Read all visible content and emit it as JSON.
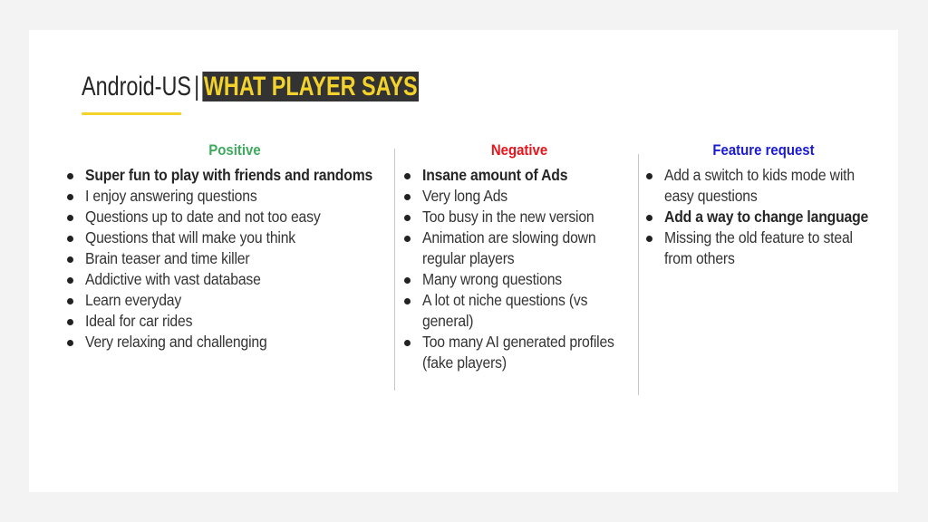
{
  "title": {
    "prefix": "Android-US",
    "separator": "|",
    "highlight": "WHAT PLAYER SAYS"
  },
  "colors": {
    "positive": "#3daa5c",
    "negative": "#e8141c",
    "feature": "#1a1ad6",
    "accent": "#f2d22b",
    "highlight_bg": "#333333"
  },
  "columns": {
    "positive": {
      "heading": "Positive",
      "items": [
        {
          "text": "Super fun to play with friends and randoms",
          "bold": true
        },
        {
          "text": "I enjoy answering questions",
          "bold": false
        },
        {
          "text": "Questions up to date and not too easy",
          "bold": false
        },
        {
          "text": "Questions that will make you think",
          "bold": false
        },
        {
          "text": "Brain teaser and time killer",
          "bold": false
        },
        {
          "text": "Addictive with vast database",
          "bold": false
        },
        {
          "text": "Learn everyday",
          "bold": false
        },
        {
          "text": "Ideal for car rides",
          "bold": false
        },
        {
          "text": "Very relaxing and challenging",
          "bold": false
        }
      ]
    },
    "negative": {
      "heading": "Negative",
      "items": [
        {
          "lines": [
            "Insane amount of Ads"
          ],
          "bold": true
        },
        {
          "lines": [
            "Very long Ads"
          ],
          "bold": false
        },
        {
          "lines": [
            "Too busy in the new version"
          ],
          "bold": false
        },
        {
          "lines": [
            "Animation are slowing down",
            "regular players"
          ],
          "bold": false
        },
        {
          "lines": [
            "Many wrong questions"
          ],
          "bold": false
        },
        {
          "lines": [
            "A lot ot niche questions (vs",
            "general)"
          ],
          "bold": false
        },
        {
          "lines": [
            "Too many AI generated profiles",
            "(fake players)"
          ],
          "bold": false
        }
      ]
    },
    "feature": {
      "heading": "Feature request",
      "items": [
        {
          "lines": [
            "Add a switch to kids mode with",
            "easy questions"
          ],
          "bold": false
        },
        {
          "lines": [
            "Add a way to change language"
          ],
          "bold": true
        },
        {
          "lines": [
            "Missing the old feature to steal",
            "from others"
          ],
          "bold": false
        }
      ]
    }
  }
}
